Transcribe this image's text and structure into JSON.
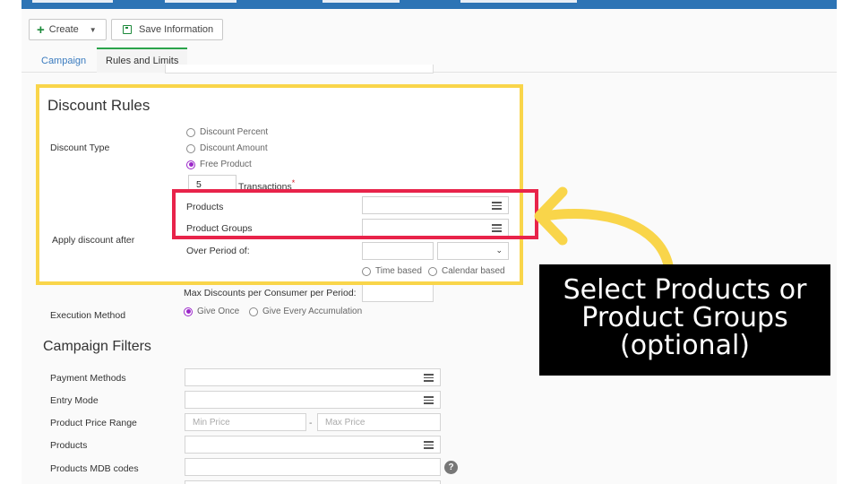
{
  "toolbar": {
    "create_label": "Create",
    "save_label": "Save Information"
  },
  "tabs": [
    {
      "label": "Campaign"
    },
    {
      "label": "Rules and Limits"
    }
  ],
  "discount_rules": {
    "title": "Discount Rules",
    "discount_type_label": "Discount Type",
    "options": [
      {
        "label": "Discount Percent",
        "checked": false
      },
      {
        "label": "Discount Amount",
        "checked": false
      },
      {
        "label": "Free Product",
        "checked": true
      }
    ],
    "transactions_value": "5",
    "transactions_label": "Transactions",
    "required_mark": "*",
    "apply_after_label": "Apply discount after",
    "products_label": "Products",
    "product_groups_label": "Product Groups",
    "over_period_label": "Over Period of:",
    "time_based_label": "Time based",
    "calendar_based_label": "Calendar based"
  },
  "limits": {
    "max_discounts_label": "Max Discounts per Consumer per Period:",
    "execution_method_label": "Execution Method",
    "give_once_label": "Give Once",
    "give_every_label": "Give Every Accumulation"
  },
  "campaign_filters": {
    "title": "Campaign Filters",
    "payment_methods_label": "Payment Methods",
    "entry_mode_label": "Entry Mode",
    "price_range_label": "Product Price Range",
    "min_price_placeholder": "Min Price",
    "range_separator": "-",
    "max_price_placeholder": "Max Price",
    "products_label": "Products",
    "mdb_codes_label": "Products MDB codes",
    "help_glyph": "?"
  },
  "callout": {
    "lines": [
      "Select Products or",
      "Product Groups",
      "(optional)"
    ]
  },
  "colors": {
    "highlight_yellow": "#f9d54a",
    "highlight_red": "#e8234a",
    "radio_checked": "#9b27c9",
    "topbar_blue": "#2d74b5",
    "tab_active_green": "#2aa34a"
  }
}
